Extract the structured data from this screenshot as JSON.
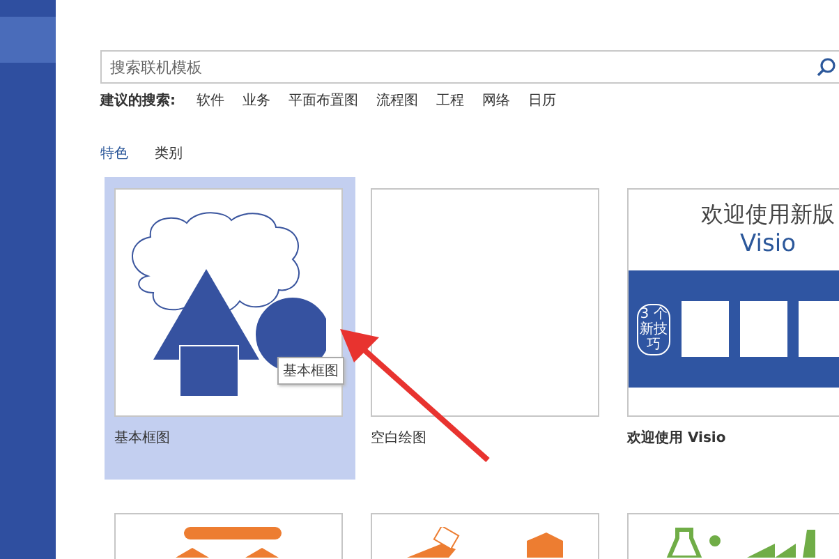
{
  "search": {
    "placeholder": "搜索联机模板"
  },
  "suggested": {
    "label": "建议的搜索:",
    "items": [
      "软件",
      "业务",
      "平面布置图",
      "流程图",
      "工程",
      "网络",
      "日历"
    ]
  },
  "tabs": [
    {
      "label": "特色",
      "selected": true
    },
    {
      "label": "类别",
      "selected": false
    }
  ],
  "templates": [
    {
      "kind": "basic",
      "label": "基本框图",
      "selected": true,
      "tooltip": "基本框图"
    },
    {
      "kind": "blank",
      "label": "空白绘图",
      "selected": false
    },
    {
      "kind": "welcome",
      "label": "欢迎使用 Visio",
      "selected": false,
      "headline": "欢迎使用新版",
      "product": "Visio",
      "badge": "3 个新技巧"
    },
    {
      "kind": "blocks",
      "selected": false
    },
    {
      "kind": "boxes",
      "selected": false
    },
    {
      "kind": "lab",
      "selected": false
    }
  ]
}
